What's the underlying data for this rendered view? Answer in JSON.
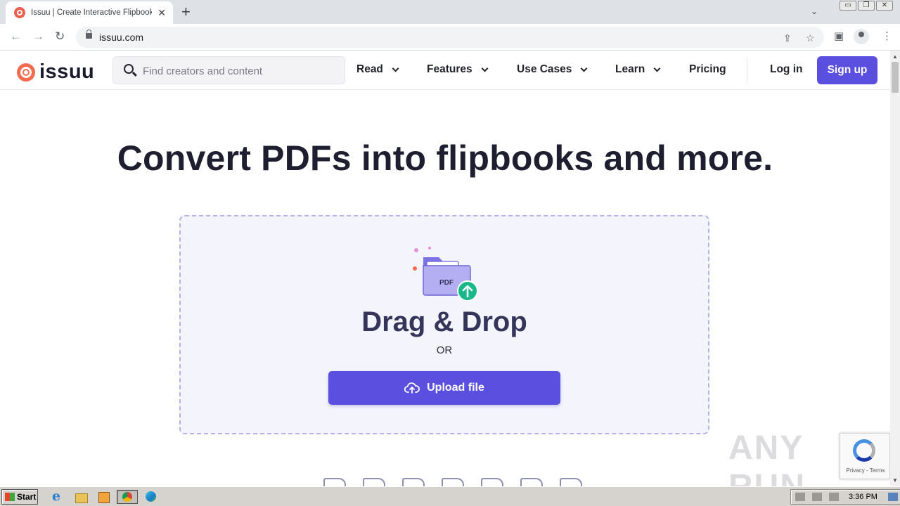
{
  "browser": {
    "tab_title": "Issuu | Create Interactive Flipbooks",
    "tab_close": "✕",
    "new_tab": "+",
    "url": "issuu.com",
    "window_controls": [
      "▭",
      "❐",
      "✕"
    ]
  },
  "site": {
    "logo_text": "issuu",
    "search_placeholder": "Find creators and content",
    "nav": {
      "read": "Read",
      "features": "Features",
      "use_cases": "Use Cases",
      "learn": "Learn",
      "pricing": "Pricing"
    },
    "login": "Log in",
    "signup": "Sign up"
  },
  "hero": {
    "title": "Convert PDFs into flipbooks and more."
  },
  "dropzone": {
    "badge": "PDF",
    "title": "Drag & Drop",
    "or": "OR",
    "upload_label": "Upload file"
  },
  "overlay": {
    "watermark": "ANY RUN",
    "recaptcha_text": "Privacy - Terms"
  },
  "taskbar": {
    "start": "Start",
    "clock": "3:36 PM"
  },
  "colors": {
    "accent": "#5b4fe0",
    "brand": "#f36a4f",
    "dropzone_bg": "#f4f4fd"
  }
}
